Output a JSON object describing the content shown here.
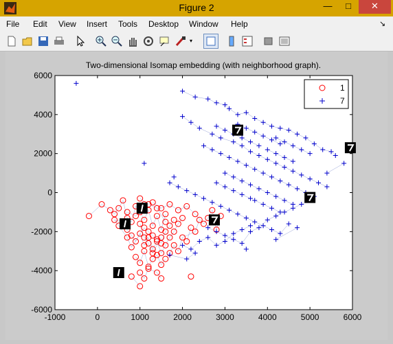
{
  "window": {
    "title": "Figure 2",
    "min_label": "—",
    "max_label": "□",
    "close_label": "✕"
  },
  "menu": [
    "File",
    "Edit",
    "View",
    "Insert",
    "Tools",
    "Desktop",
    "Window",
    "Help"
  ],
  "menu_extra": "↘",
  "toolbar": [
    "new-figure-icon",
    "open-icon",
    "save-icon",
    "print-icon",
    "select-arrow-icon",
    "zoom-in-icon",
    "zoom-out-icon",
    "pan-hand-icon",
    "rotate-icon",
    "data-cursor-icon",
    "brush-icon",
    "link-icon",
    "colorbar-icon",
    "legend-icon",
    "hide-plot-tools-icon",
    "show-plot-tools-icon"
  ],
  "chart_data": {
    "type": "scatter",
    "title": "Two-dimensional Isomap embedding (with neighborhood graph).",
    "xlim": [
      -1000,
      6000
    ],
    "ylim": [
      -6000,
      6000
    ],
    "xticks": [
      -1000,
      0,
      1000,
      2000,
      3000,
      4000,
      5000,
      6000
    ],
    "yticks": [
      -6000,
      -4000,
      -2000,
      0,
      2000,
      4000,
      6000
    ],
    "legend": {
      "position": "top-right",
      "entries": [
        "1",
        "7"
      ]
    },
    "series": [
      {
        "name": "1",
        "marker": "o",
        "color": "#ff0000",
        "points": [
          [
            -200,
            -1200
          ],
          [
            100,
            -600
          ],
          [
            300,
            -900
          ],
          [
            400,
            -1100
          ],
          [
            500,
            -800
          ],
          [
            600,
            -400
          ],
          [
            700,
            -1300
          ],
          [
            800,
            -1500
          ],
          [
            900,
            -700
          ],
          [
            1000,
            -1000
          ],
          [
            1100,
            -1400
          ],
          [
            1200,
            -900
          ],
          [
            1300,
            -1700
          ],
          [
            1400,
            -1200
          ],
          [
            1500,
            -1900
          ],
          [
            1600,
            -1100
          ],
          [
            700,
            -1900
          ],
          [
            800,
            -2200
          ],
          [
            900,
            -2500
          ],
          [
            1000,
            -2100
          ],
          [
            1100,
            -2700
          ],
          [
            1200,
            -2300
          ],
          [
            1300,
            -2900
          ],
          [
            1400,
            -2500
          ],
          [
            1500,
            -3100
          ],
          [
            1600,
            -2700
          ],
          [
            1700,
            -2300
          ],
          [
            1800,
            -2000
          ],
          [
            1900,
            -1600
          ],
          [
            2000,
            -1300
          ],
          [
            2100,
            -2500
          ],
          [
            2200,
            -1800
          ],
          [
            900,
            -3300
          ],
          [
            1000,
            -3600
          ],
          [
            1100,
            -3000
          ],
          [
            1200,
            -3800
          ],
          [
            1300,
            -3400
          ],
          [
            1400,
            -3200
          ],
          [
            1500,
            -3700
          ],
          [
            1600,
            -3400
          ],
          [
            1000,
            -4100
          ],
          [
            1100,
            -4400
          ],
          [
            1200,
            -3900
          ],
          [
            1400,
            -4100
          ],
          [
            1500,
            -4400
          ],
          [
            800,
            -4300
          ],
          [
            1000,
            -4800
          ],
          [
            2200,
            -4300
          ],
          [
            1700,
            -3100
          ],
          [
            1800,
            -2700
          ],
          [
            1900,
            -3000
          ],
          [
            2000,
            -2300
          ],
          [
            2300,
            -2000
          ],
          [
            2400,
            -1400
          ],
          [
            1300,
            -500
          ],
          [
            1500,
            -800
          ],
          [
            1700,
            -600
          ],
          [
            1900,
            -900
          ],
          [
            2100,
            -700
          ],
          [
            2300,
            -1100
          ],
          [
            2500,
            -1600
          ],
          [
            2600,
            -1300
          ],
          [
            2700,
            -900
          ],
          [
            2800,
            -1900
          ],
          [
            2900,
            -1200
          ],
          [
            600,
            -1500
          ],
          [
            400,
            -1400
          ],
          [
            500,
            -1700
          ],
          [
            700,
            -2300
          ],
          [
            800,
            -2800
          ],
          [
            1100,
            -1800
          ],
          [
            1200,
            -2000
          ],
          [
            1300,
            -2200
          ],
          [
            1400,
            -2400
          ],
          [
            1500,
            -2600
          ],
          [
            1600,
            -2000
          ],
          [
            1700,
            -1700
          ],
          [
            1800,
            -1400
          ],
          [
            1000,
            -300
          ],
          [
            1200,
            -600
          ],
          [
            1400,
            -800
          ],
          [
            1600,
            -1500
          ],
          [
            700,
            -1000
          ],
          [
            900,
            -1200
          ],
          [
            1100,
            -600
          ],
          [
            1500,
            -2300
          ],
          [
            1300,
            -3100
          ],
          [
            1200,
            -2600
          ],
          [
            1100,
            -2300
          ],
          [
            1000,
            -1600
          ]
        ]
      },
      {
        "name": "7",
        "marker": "+",
        "color": "#0000cd",
        "points": [
          [
            -500,
            5600
          ],
          [
            2000,
            5200
          ],
          [
            2300,
            4900
          ],
          [
            2600,
            4800
          ],
          [
            2800,
            4600
          ],
          [
            3000,
            4500
          ],
          [
            3100,
            4300
          ],
          [
            3300,
            4000
          ],
          [
            3500,
            4100
          ],
          [
            3700,
            3800
          ],
          [
            3900,
            3600
          ],
          [
            4100,
            3400
          ],
          [
            4300,
            3300
          ],
          [
            4500,
            3200
          ],
          [
            4700,
            3000
          ],
          [
            4900,
            2800
          ],
          [
            5100,
            2500
          ],
          [
            5300,
            2200
          ],
          [
            5500,
            2100
          ],
          [
            5600,
            1900
          ],
          [
            2000,
            3900
          ],
          [
            2200,
            3600
          ],
          [
            2400,
            3300
          ],
          [
            2700,
            3000
          ],
          [
            2900,
            2800
          ],
          [
            3200,
            2600
          ],
          [
            3400,
            2400
          ],
          [
            3600,
            2100
          ],
          [
            3800,
            1900
          ],
          [
            4000,
            1700
          ],
          [
            4200,
            1500
          ],
          [
            4400,
            1300
          ],
          [
            4600,
            1100
          ],
          [
            4800,
            900
          ],
          [
            5000,
            700
          ],
          [
            5200,
            500
          ],
          [
            5400,
            300
          ],
          [
            2500,
            2400
          ],
          [
            2700,
            2200
          ],
          [
            2900,
            2000
          ],
          [
            3100,
            1800
          ],
          [
            3300,
            1600
          ],
          [
            3500,
            1400
          ],
          [
            3700,
            1200
          ],
          [
            3900,
            1000
          ],
          [
            4100,
            800
          ],
          [
            4300,
            600
          ],
          [
            4500,
            400
          ],
          [
            4700,
            200
          ],
          [
            4900,
            0
          ],
          [
            5100,
            -200
          ],
          [
            1700,
            500
          ],
          [
            1900,
            300
          ],
          [
            2100,
            100
          ],
          [
            2300,
            -100
          ],
          [
            2500,
            -300
          ],
          [
            2700,
            -500
          ],
          [
            2900,
            -700
          ],
          [
            3100,
            -900
          ],
          [
            3300,
            -1100
          ],
          [
            3500,
            -1300
          ],
          [
            3700,
            -1500
          ],
          [
            3900,
            -1700
          ],
          [
            4100,
            -1900
          ],
          [
            4300,
            -2100
          ],
          [
            4500,
            -1600
          ],
          [
            2600,
            -1800
          ],
          [
            2800,
            -2000
          ],
          [
            3000,
            -2200
          ],
          [
            3200,
            -2400
          ],
          [
            3400,
            -2600
          ],
          [
            3600,
            -2000
          ],
          [
            3800,
            -1800
          ],
          [
            4000,
            -1400
          ],
          [
            4200,
            -1200
          ],
          [
            4400,
            -1000
          ],
          [
            4600,
            -800
          ],
          [
            4800,
            -600
          ],
          [
            5000,
            -400
          ],
          [
            1100,
            1500
          ],
          [
            1800,
            800
          ],
          [
            2000,
            -2700
          ],
          [
            2200,
            -2900
          ],
          [
            2400,
            -2500
          ],
          [
            2600,
            -2300
          ],
          [
            2800,
            -2700
          ],
          [
            3000,
            -2500
          ],
          [
            3200,
            -2100
          ],
          [
            3400,
            -1900
          ],
          [
            3600,
            -1700
          ],
          [
            1700,
            -3200
          ],
          [
            2100,
            -3400
          ],
          [
            2300,
            -3100
          ],
          [
            4200,
            2800
          ],
          [
            4400,
            2600
          ],
          [
            4600,
            2400
          ],
          [
            4800,
            2200
          ],
          [
            5000,
            2000
          ],
          [
            3300,
            3500
          ],
          [
            3500,
            3300
          ],
          [
            3700,
            3100
          ],
          [
            3900,
            2900
          ],
          [
            4100,
            2700
          ],
          [
            4300,
            2500
          ],
          [
            3000,
            1000
          ],
          [
            3200,
            800
          ],
          [
            3400,
            600
          ],
          [
            3600,
            400
          ],
          [
            3800,
            200
          ],
          [
            4000,
            0
          ],
          [
            4200,
            -200
          ],
          [
            4400,
            -400
          ],
          [
            4600,
            -600
          ],
          [
            3700,
            -400
          ],
          [
            3900,
            -600
          ],
          [
            4100,
            -800
          ],
          [
            4300,
            -1000
          ],
          [
            2800,
            500
          ],
          [
            3000,
            300
          ],
          [
            3200,
            100
          ],
          [
            3400,
            -100
          ],
          [
            3600,
            -300
          ],
          [
            4000,
            2200
          ],
          [
            4200,
            2000
          ],
          [
            4400,
            1800
          ],
          [
            4600,
            1600
          ],
          [
            3800,
            2400
          ],
          [
            3600,
            2600
          ],
          [
            3400,
            2800
          ],
          [
            3200,
            3000
          ],
          [
            3000,
            3200
          ],
          [
            2800,
            3400
          ],
          [
            5800,
            1500
          ],
          [
            5400,
            1000
          ],
          [
            4700,
            -1800
          ],
          [
            4200,
            -2400
          ],
          [
            3500,
            -2900
          ]
        ]
      }
    ],
    "image_markers": [
      "digit-1-image",
      "digit-1-image",
      "digit-1-image",
      "digit-7-image",
      "digit-7-image",
      "digit-7-image",
      "digit-7-image"
    ]
  }
}
